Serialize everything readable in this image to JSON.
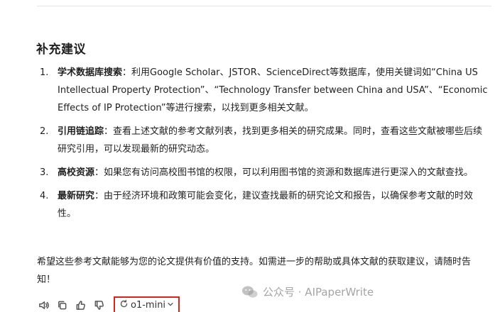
{
  "section": {
    "heading": "补充建议"
  },
  "items": [
    {
      "num": "1.",
      "term": "学术数据库搜索",
      "sep": "：",
      "text": "利用Google Scholar、JSTOR、ScienceDirect等数据库，使用关键词如“China US Intellectual Property Protection”、“Technology Transfer between China and USA”、“Economic Effects of IP Protection”等进行搜索，以找到更多相关文献。"
    },
    {
      "num": "2.",
      "term": "引用链追踪",
      "sep": "：",
      "text": "查看上述文献的参考文献列表，找到更多相关的研究成果。同时，查看这些文献被哪些后续研究引用，可以发现最新的研究动态。"
    },
    {
      "num": "3.",
      "term": "高校资源",
      "sep": "：",
      "text": "如果您有访问高校图书馆的权限，可以利用图书馆的资源和数据库进行更深入的文献查找。"
    },
    {
      "num": "4.",
      "term": "最新研究",
      "sep": "：",
      "text": "由于经济环境和政策可能会变化，建议查找最新的研究论文和报告，以确保参考文献的时效性。"
    }
  ],
  "closing": "希望这些参考文献能够为您的论文提供有价值的支持。如需进一步的帮助或具体文献的获取建议，请随时告知！",
  "toolbar": {
    "icons": [
      "speaker-icon",
      "copy-icon",
      "thumbs-up-icon",
      "thumbs-down-icon"
    ],
    "model_label": "o1-mini",
    "accent": "#d9241b"
  },
  "watermark": {
    "text": "公众号 · AIPaperWrite"
  }
}
